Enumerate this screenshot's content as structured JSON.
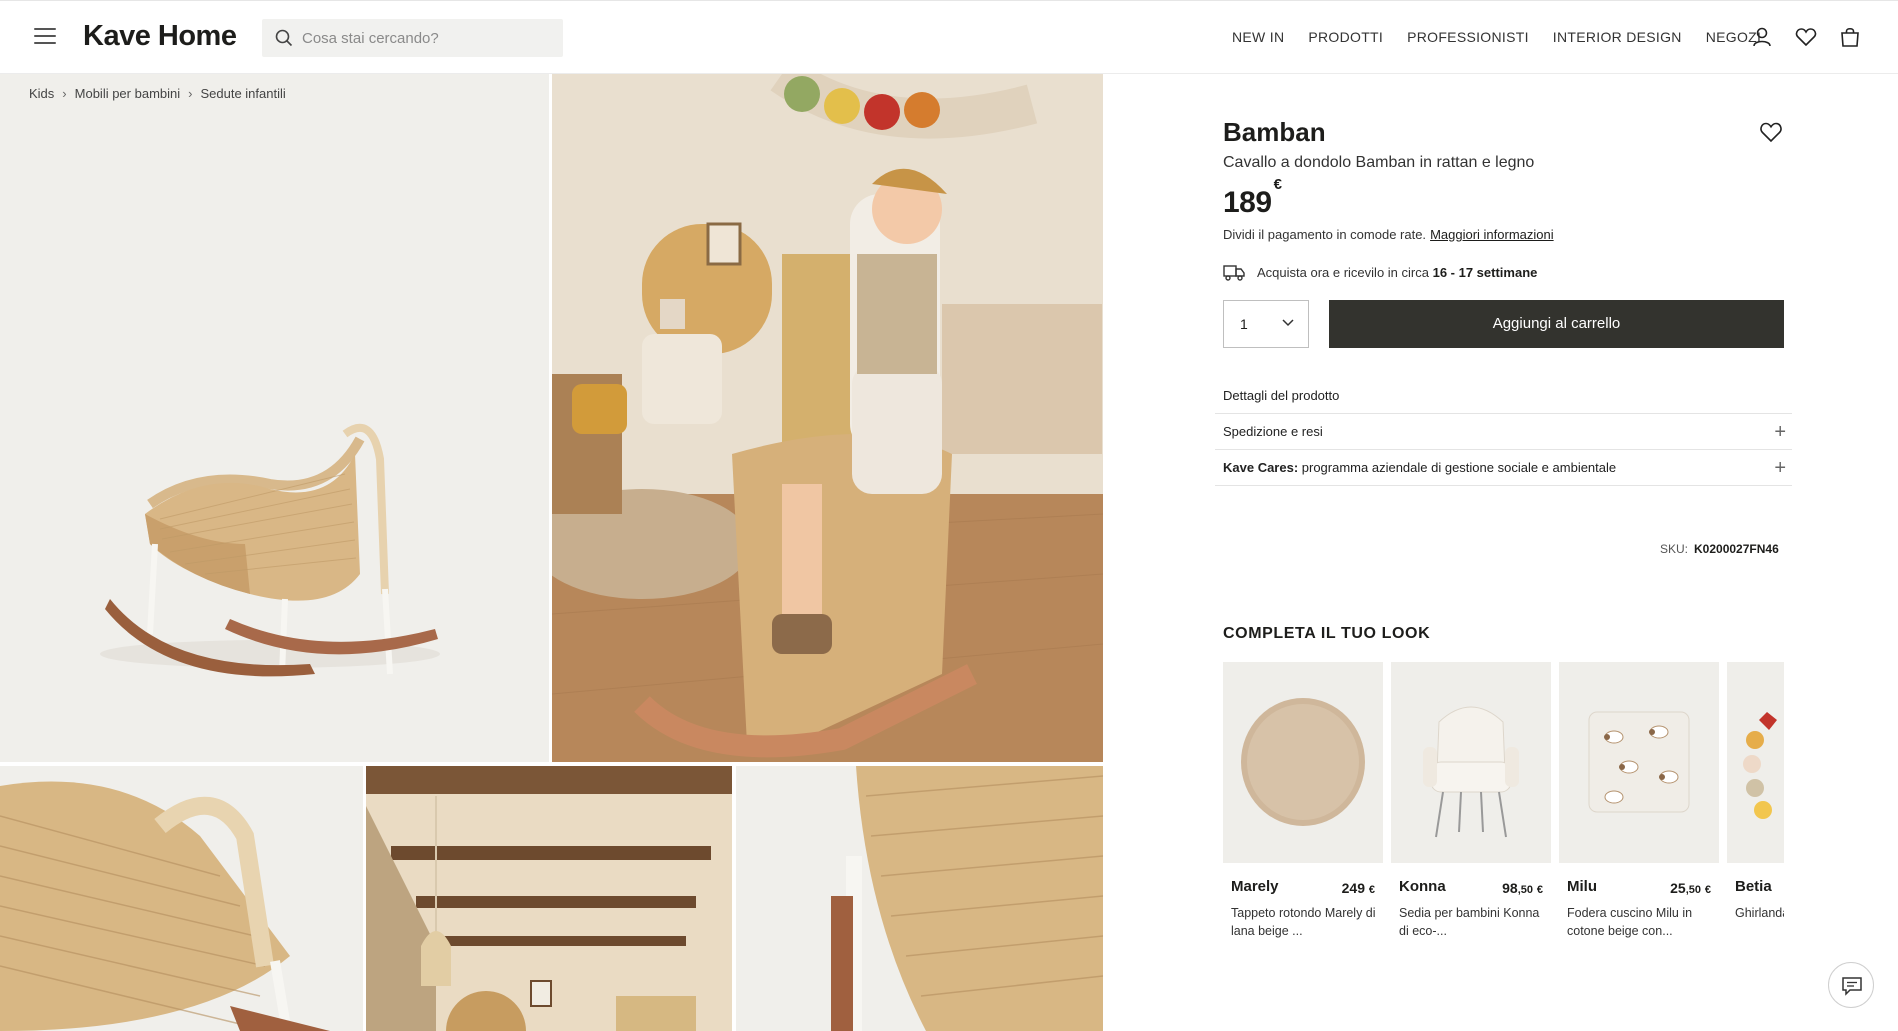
{
  "header": {
    "logo": "Kave Home",
    "search_placeholder": "Cosa stai cercando?",
    "nav": [
      "NEW IN",
      "PRODOTTI",
      "PROFESSIONISTI",
      "INTERIOR DESIGN",
      "NEGOZI"
    ],
    "icons": [
      "user-icon",
      "heart-icon",
      "bag-icon"
    ]
  },
  "breadcrumb": [
    "Kids",
    "Mobili per bambini",
    "Sedute infantili"
  ],
  "product": {
    "name": "Bamban",
    "subtitle": "Cavallo a dondolo Bamban in rattan e legno",
    "price": "189",
    "currency": "€",
    "installments_text": "Dividi il pagamento in comode rate.",
    "installments_link": "Maggiori informazioni",
    "delivery_text": "Acquista ora e ricevilo in circa",
    "delivery_time": "16 - 17 settimane",
    "quantity": "1",
    "add_to_cart": "Aggiungi al carrello",
    "accordion": {
      "details": "Dettagli del prodotto",
      "shipping": "Spedizione e resi",
      "cares_bold": "Kave Cares:",
      "cares_text": " programma aziendale di gestione sociale e ambientale"
    },
    "sku_label": "SKU:",
    "sku": "K0200027FN46"
  },
  "look": {
    "title": "COMPLETA IL TUO LOOK",
    "items": [
      {
        "name": "Marely",
        "price_int": "249",
        "price_dec": "",
        "currency": "€",
        "desc": "Tappeto rotondo Marely di lana beige ..."
      },
      {
        "name": "Konna",
        "price_int": "98",
        "price_dec": ",50",
        "currency": "€",
        "desc": "Sedia per bambini Konna di eco-..."
      },
      {
        "name": "Milu",
        "price_int": "25",
        "price_dec": ",50",
        "currency": "€",
        "desc": "Fodera cuscino Milu in cotone beige con..."
      },
      {
        "name": "Betia",
        "price_int": "",
        "price_dec": "",
        "currency": "",
        "desc": "Ghirlanda bandieri"
      }
    ]
  },
  "colors": {
    "accent_dark": "#33332e",
    "gallery_bg": "#f0efeb"
  }
}
